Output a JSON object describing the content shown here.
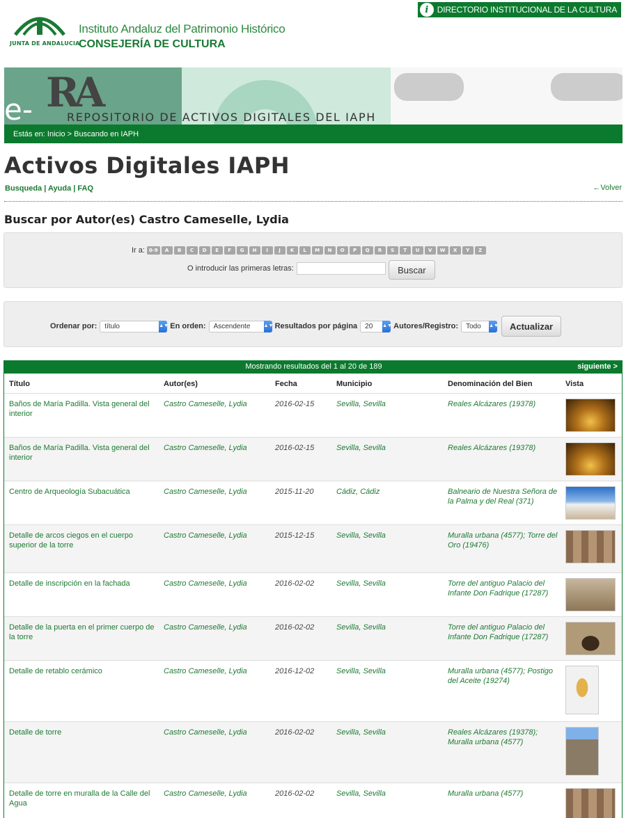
{
  "header": {
    "logo_caption": "JUNTA DE ANDALUCIA",
    "institute": "Instituto Andaluz del Patrimonio Histórico",
    "consejeria": "CONSEJERÍA DE CULTURA",
    "directorio": "DIRECTORIO INSTITUCIONAL DE LA CULTURA"
  },
  "banner": {
    "logo_letters": "RA",
    "logo_prefix": "e-",
    "title": "REPOSITORIO DE ACTIVOS DIGITALES DEL IAPH"
  },
  "breadcrumb": "Estás en: Inicio > Buscando en IAPH",
  "page": {
    "title": "Activos Digitales IAPH",
    "nav": [
      "Busqueda",
      "Ayuda",
      "FAQ"
    ],
    "nav_sep": " | ",
    "back": "←Volver",
    "search_title": "Buscar por Autor(es) Castro Cameselle, Lydia"
  },
  "alpha": {
    "label": "Ir a:",
    "letters": [
      "0-9",
      "A",
      "B",
      "C",
      "D",
      "E",
      "F",
      "G",
      "H",
      "I",
      "J",
      "K",
      "L",
      "M",
      "N",
      "O",
      "P",
      "Q",
      "R",
      "S",
      "T",
      "U",
      "V",
      "W",
      "X",
      "Y",
      "Z"
    ],
    "intro_label": "O introducir las primeras letras:",
    "input_value": "",
    "button": "Buscar"
  },
  "sort": {
    "order_by_label": "Ordenar por:",
    "order_by_value": "título",
    "order_label": "En orden:",
    "order_value": "Ascendente",
    "per_page_label": "Resultados por página",
    "per_page_value": "20",
    "authors_label": "Autores/Registro:",
    "authors_value": "Todo",
    "button": "Actualizar"
  },
  "results": {
    "summary": "Mostrando resultados del 1 al 20 de 189",
    "next": "siguiente >",
    "columns": [
      "Título",
      "Autor(es)",
      "Fecha",
      "Municipio",
      "Denominación del Bien",
      "Vista"
    ],
    "rows": [
      {
        "title": "Baños de María Padilla. Vista general del interior",
        "author": "Castro Cameselle, Lydia",
        "date": "2016-02-15",
        "municipio": "Sevilla, Sevilla",
        "bien": "Reales Alcázares (19378)",
        "thumb": "baths"
      },
      {
        "title": "Baños de María Padilla. Vista general del interior",
        "author": "Castro Cameselle, Lydia",
        "date": "2016-02-15",
        "municipio": "Sevilla, Sevilla",
        "bien": "Reales Alcázares (19378)",
        "thumb": "baths"
      },
      {
        "title": "Centro de Arqueología Subacuática",
        "author": "Castro Cameselle, Lydia",
        "date": "2015-11-20",
        "municipio": "Cádiz, Cádiz",
        "bien": "Balneario de Nuestra Señora de la Palma y del Real (371)",
        "thumb": "sea"
      },
      {
        "title": "Detalle de arcos ciegos en el cuerpo superior de la torre",
        "author": "Castro Cameselle, Lydia",
        "date": "2015-12-15",
        "municipio": "Sevilla, Sevilla",
        "bien": "Muralla urbana (4577); Torre del Oro (19476)",
        "thumb": "stone"
      },
      {
        "title": "Detalle de inscripción en la fachada",
        "author": "Castro Cameselle, Lydia",
        "date": "2016-02-02",
        "municipio": "Sevilla, Sevilla",
        "bien": "Torre del antiguo Palacio del Infante Don Fadrique (17287)",
        "thumb": "wall"
      },
      {
        "title": "Detalle de la puerta en el primer cuerpo de la torre",
        "author": "Castro Cameselle, Lydia",
        "date": "2016-02-02",
        "municipio": "Sevilla, Sevilla",
        "bien": "Torre del antiguo Palacio del Infante Don Fadrique (17287)",
        "thumb": "door"
      },
      {
        "title": "Detalle de retablo cerámico",
        "author": "Castro Cameselle, Lydia",
        "date": "2016-12-02",
        "municipio": "Sevilla, Sevilla",
        "bien": "Muralla urbana (4577); Postigo del Aceite (19274)",
        "thumb": "altar"
      },
      {
        "title": "Detalle de torre",
        "author": "Castro Cameselle, Lydia",
        "date": "2016-02-02",
        "municipio": "Sevilla, Sevilla",
        "bien": "Reales Alcázares (19378); Muralla urbana (4577)",
        "thumb": "tower"
      },
      {
        "title": "Detalle de torre en muralla de la Calle del Agua",
        "author": "Castro Cameselle, Lydia",
        "date": "2016-02-02",
        "municipio": "Sevilla, Sevilla",
        "bien": "Muralla urbana (4577)",
        "thumb": "stone"
      }
    ]
  }
}
